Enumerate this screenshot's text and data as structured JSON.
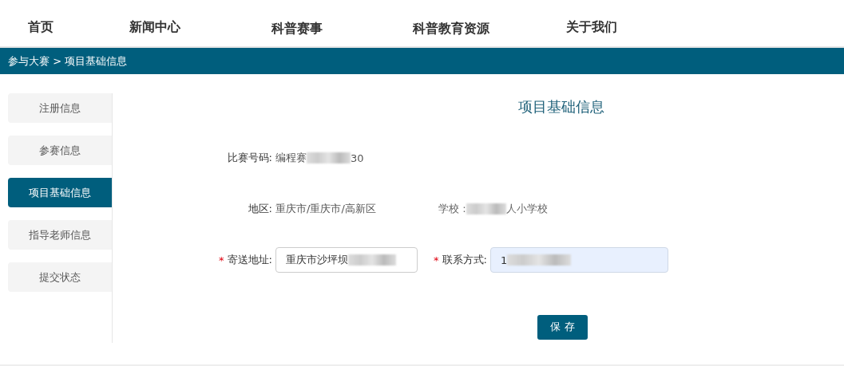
{
  "nav": [
    {
      "label": "首页",
      "selected": false
    },
    {
      "label": "新闻中心",
      "selected": false
    },
    {
      "label": "科普赛事",
      "selected": false
    },
    {
      "label": "科普教育资源",
      "selected": false
    },
    {
      "label": "关于我们",
      "selected": false
    }
  ],
  "breadcrumb": "参与大赛 > 项目基础信息",
  "sidebar": [
    {
      "label": "注册信息",
      "selected": false
    },
    {
      "label": "参赛信息",
      "selected": false
    },
    {
      "label": "项目基础信息",
      "selected": true
    },
    {
      "label": "指导老师信息",
      "selected": false
    },
    {
      "label": "提交状态",
      "selected": false
    }
  ],
  "title": "项目基础信息",
  "code": {
    "label": "比赛号码:",
    "value_start": "编程赛",
    "value_end": "30",
    "redacted": true
  },
  "region": {
    "label": "地区:",
    "value": "重庆市/重庆市/高新区"
  },
  "school": {
    "label": "学校 :",
    "value_end": "人小学校",
    "redacted": true
  },
  "address": {
    "label": "寄送地址:",
    "required_mark": "*",
    "value": "重庆市沙坪坝",
    "redacted": true,
    "autofilled": false
  },
  "contact": {
    "label": "联系方式:",
    "required_mark": "*",
    "value": "1",
    "redacted": true,
    "autofilled": true
  },
  "save_button": "保 存"
}
